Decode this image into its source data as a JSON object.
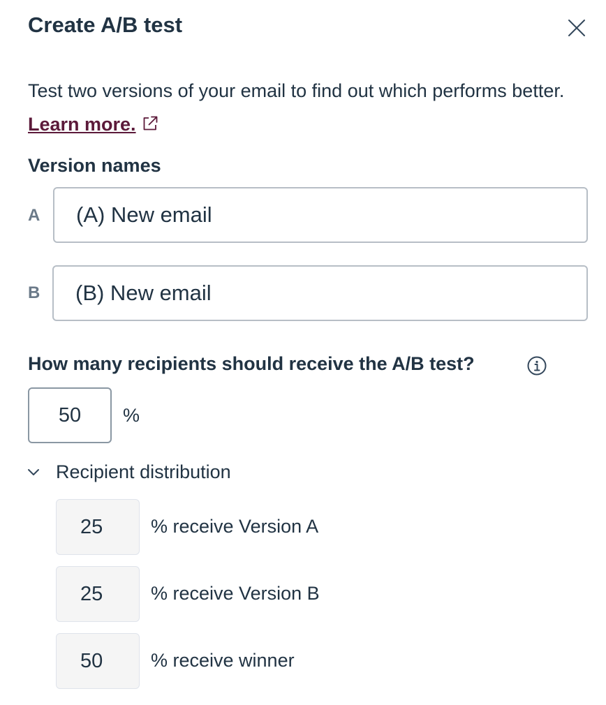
{
  "dialog": {
    "title": "Create A/B test",
    "close_icon": "close-icon"
  },
  "description": {
    "text": "Test two versions of your email to find out which performs better.",
    "link_label": "Learn more.",
    "link_icon": "external-link-icon"
  },
  "versions": {
    "label": "Version names",
    "a": {
      "letter": "A",
      "value": "(A) New email"
    },
    "b": {
      "letter": "B",
      "value": "(B) New email"
    }
  },
  "recipients": {
    "question": "How many recipients should receive the A/B test?",
    "info_icon": "info-icon",
    "percent_value": "50",
    "percent_sign": "%"
  },
  "distribution": {
    "toggle_label": "Recipient distribution",
    "toggle_icon": "chevron-down-icon",
    "rows": [
      {
        "value": "25",
        "label": "% receive Version A"
      },
      {
        "value": "25",
        "label": "% receive Version B"
      },
      {
        "value": "50",
        "label": "% receive winner"
      }
    ]
  },
  "colors": {
    "text": "#213343",
    "link": "#5c1a3a",
    "border": "#b7bec6",
    "readonly_bg": "#f5f5f5"
  }
}
